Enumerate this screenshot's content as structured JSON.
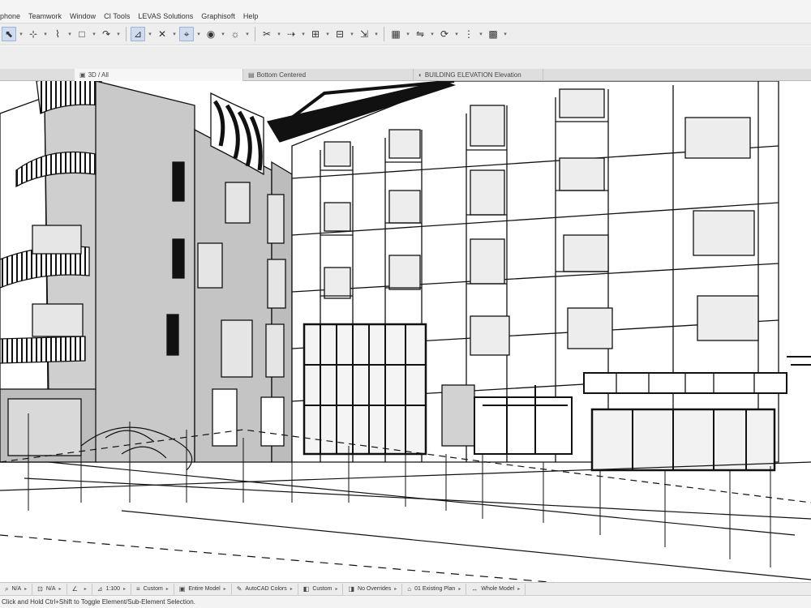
{
  "menubar": {
    "items": [
      "phone",
      "Teamwork",
      "Window",
      "CI Tools",
      "LEVAS Solutions",
      "Graphisoft",
      "Help"
    ]
  },
  "toolbar": {
    "buttons": [
      {
        "icon": "arrow-select-icon",
        "selected": true
      },
      {
        "icon": "marquee-icon",
        "selected": false
      },
      {
        "icon": "wall-icon",
        "selected": false
      },
      {
        "icon": "rectangle-icon",
        "selected": false
      },
      {
        "icon": "curve-icon",
        "selected": false
      },
      {
        "icon": "snap-icon",
        "selected": true
      },
      {
        "icon": "guide-icon",
        "selected": false
      },
      {
        "icon": "gravity-icon",
        "selected": true
      },
      {
        "icon": "eye-icon",
        "selected": false
      },
      {
        "icon": "sun-icon",
        "selected": false
      },
      {
        "icon": "cut-icon",
        "selected": false
      },
      {
        "icon": "offset-icon",
        "selected": false
      },
      {
        "icon": "align-icon",
        "selected": false
      },
      {
        "icon": "distribute-icon",
        "selected": false
      },
      {
        "icon": "stretch-icon",
        "selected": false
      },
      {
        "icon": "layout-icon",
        "selected": false
      },
      {
        "icon": "mirror-icon",
        "selected": false
      },
      {
        "icon": "rotate-icon",
        "selected": false
      },
      {
        "icon": "matrix-icon",
        "selected": false
      },
      {
        "icon": "grid-icon",
        "selected": false
      }
    ]
  },
  "tabs": [
    {
      "label": "3D / All",
      "icon": "3d-view-icon",
      "active": true
    },
    {
      "label": "Bottom Centered",
      "icon": "layout-icon",
      "active": false
    },
    {
      "label": "BUILDING ELEVATION Elevation",
      "icon": "elevation-icon",
      "active": false
    }
  ],
  "quick_options": [
    {
      "icon": "magnifier-icon",
      "value": "N/A"
    },
    {
      "icon": "lock-icon",
      "value": "N/A"
    },
    {
      "icon": "angle-icon",
      "value": ""
    },
    {
      "icon": "scale-icon",
      "value": "1:100"
    },
    {
      "icon": "layer-icon",
      "value": "Custom"
    },
    {
      "icon": "model-icon",
      "value": "Entire Model"
    },
    {
      "icon": "pen-icon",
      "value": "AutoCAD Colors"
    },
    {
      "icon": "override-icon",
      "value": "Custom"
    },
    {
      "icon": "no-override-icon",
      "value": "No Overrides"
    },
    {
      "icon": "renovation-icon",
      "value": "01 Existing Plan"
    },
    {
      "icon": "dimension-icon",
      "value": "Whole Model"
    }
  ],
  "statusbar": {
    "text": "Click and Hold Ctrl+Shift to Toggle Element/Sub-Element Selection."
  },
  "colors": {
    "chrome": "#eeeeee",
    "facade_grey": "#c8c8c8",
    "line": "#111111",
    "glass": "#e3e3e3"
  }
}
